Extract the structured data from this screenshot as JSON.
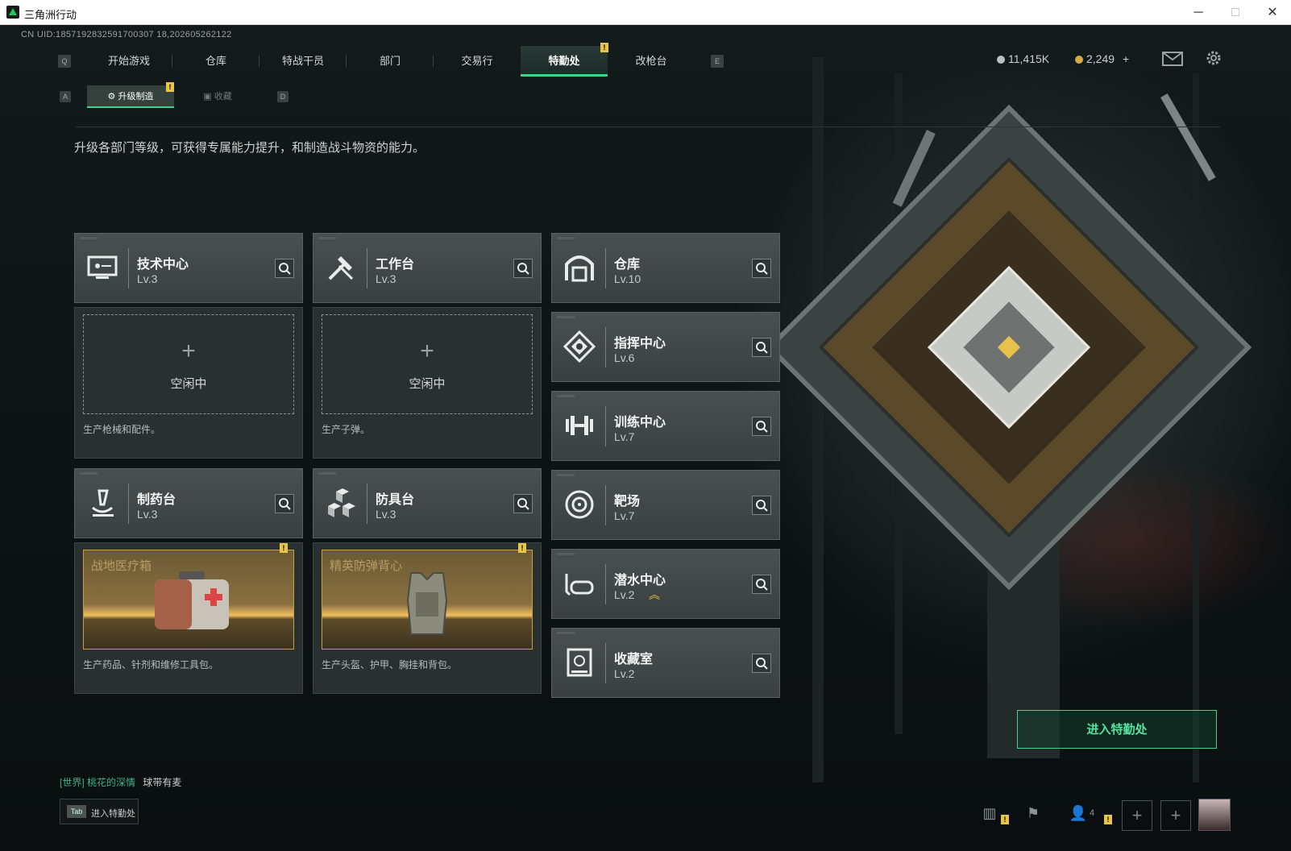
{
  "window": {
    "title": "三角洲行动",
    "controls": [
      "─",
      "□",
      "✕"
    ]
  },
  "uid_text": "CN UID:1857192832591700307 18,202605262122",
  "topnav": {
    "left_key": "Q",
    "right_key": "E",
    "tabs": [
      "开始游戏",
      "仓库",
      "特战干员",
      "部门",
      "交易行",
      "特勤处",
      "改枪台"
    ],
    "active": "特勤处"
  },
  "currency": {
    "silver": "11,415K",
    "gold": "2,249",
    "gold_add": "+"
  },
  "subnav": {
    "left_key": "A",
    "right_key": "D",
    "active_label": "升级制造",
    "inactive_label": "收藏"
  },
  "description": "升级各部门等级，可获得专属能力提升，和制造战斗物资的能力。",
  "departments": {
    "tech_center": {
      "name": "技术中心",
      "level": "Lv.3",
      "icon": "tech-screen-icon"
    },
    "workbench": {
      "name": "工作台",
      "level": "Lv.3",
      "icon": "tools-icon"
    },
    "pharmacy": {
      "name": "制药台",
      "level": "Lv.3",
      "icon": "microscope-icon"
    },
    "armor_bench": {
      "name": "防具台",
      "level": "Lv.3",
      "icon": "cubes-icon"
    },
    "warehouse": {
      "name": "仓库",
      "level": "Lv.10",
      "icon": "warehouse-icon"
    },
    "command": {
      "name": "指挥中心",
      "level": "Lv.6",
      "icon": "command-icon"
    },
    "training": {
      "name": "训练中心",
      "level": "Lv.7",
      "icon": "dumbbell-icon"
    },
    "range": {
      "name": "靶场",
      "level": "Lv.7",
      "icon": "target-icon"
    },
    "diving": {
      "name": "潜水中心",
      "level": "Lv.2",
      "icon": "diving-mask-icon"
    },
    "collection": {
      "name": "收藏室",
      "level": "Lv.2",
      "icon": "collection-icon"
    }
  },
  "production": {
    "tech": {
      "idle": "空闲中",
      "desc": "生产枪械和配件。"
    },
    "workbench": {
      "idle": "空闲中",
      "desc": "生产子弹。"
    },
    "pharmacy": {
      "item": "战地医疗箱",
      "desc": "生产药品、针剂和维修工具包。"
    },
    "armor": {
      "item": "精英防弹背心",
      "desc": "生产头盔、护甲、胸挂和背包。"
    }
  },
  "enter_button": "进入特勤处",
  "chat": {
    "channel": "[世界]",
    "user": "桃花的深情",
    "message": "球带有麦"
  },
  "tab_hint": {
    "key": "Tab",
    "label": "进入特勤处"
  },
  "bottom_bar": {
    "friends_count": "4"
  },
  "colors": {
    "accent": "#3fd38c",
    "badge": "#e8c545",
    "card": "#4a5050"
  }
}
